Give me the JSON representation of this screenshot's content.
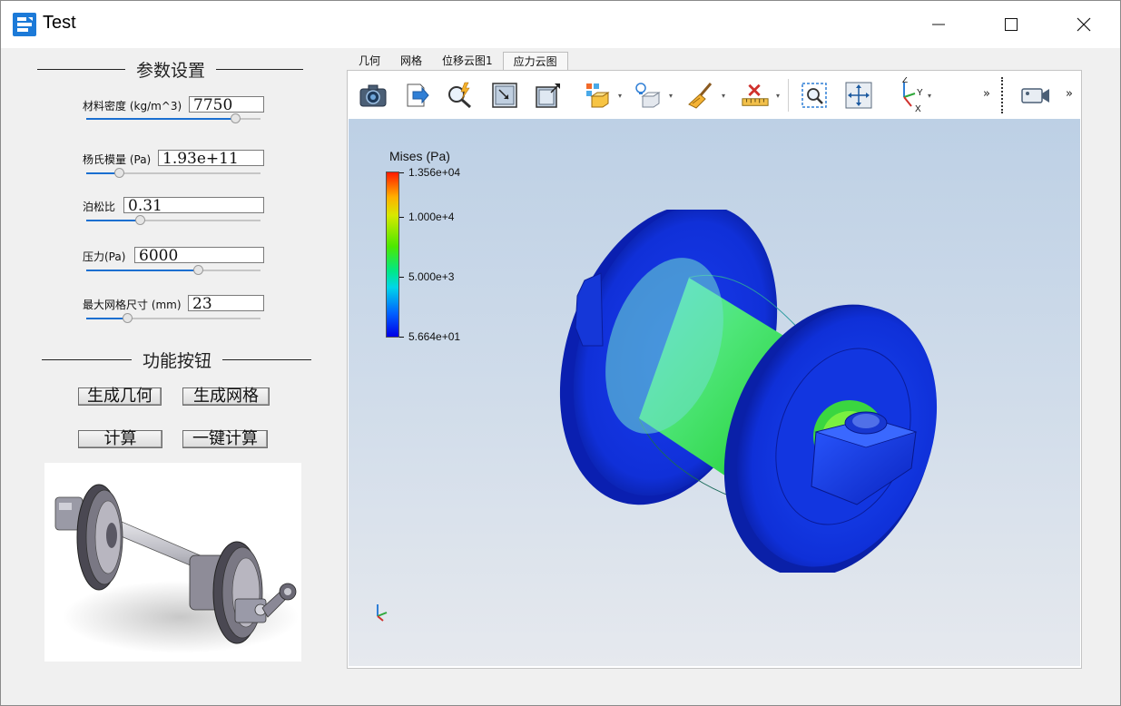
{
  "window": {
    "title": "Test"
  },
  "params_group": {
    "title": "参数设置",
    "items": [
      {
        "label": "材料密度 (kg/m^3)",
        "value": "7750",
        "slider": 0.88
      },
      {
        "label": "杨氏模量 (Pa)",
        "value": "1.93e+11",
        "slider": 0.17
      },
      {
        "label": "泊松比",
        "value": "0.31",
        "slider": 0.3
      },
      {
        "label": "压力(Pa)",
        "value": "6000",
        "slider": 0.65
      },
      {
        "label": "最大网格尺寸 (mm)",
        "value": "23",
        "slider": 0.22
      }
    ]
  },
  "buttons_group": {
    "title": "功能按钮",
    "gen_geometry": "生成几何",
    "gen_mesh": "生成网格",
    "compute": "计算",
    "one_click": "一键计算"
  },
  "tabs": [
    "几何",
    "网格",
    "位移云图1",
    "应力云图"
  ],
  "active_tab": "应力云图",
  "toolbar_icons": [
    "camera-icon",
    "export-icon",
    "zoom-query-icon",
    "fit-view-icon",
    "maximize-view-icon",
    "display-mode-icon",
    "lighting-icon",
    "clear-icon",
    "ruler-icon",
    "zoom-box-icon",
    "pan-icon",
    "axes-icon",
    "more-icon",
    "video-camera-icon",
    "more-icon"
  ],
  "axes_labels": {
    "z": "Z",
    "y": "Y",
    "x": "X"
  },
  "legend": {
    "title": "Mises (Pa)",
    "labels": [
      "1.356e+04",
      "1.000e+4",
      "5.000e+3",
      "5.664e+01"
    ],
    "max": 13560,
    "min": 56.64
  },
  "colors": {
    "accent": "#1a6fd0",
    "viewport_top": "#bdd0e5",
    "viewport_bottom": "#e6e9ee"
  }
}
